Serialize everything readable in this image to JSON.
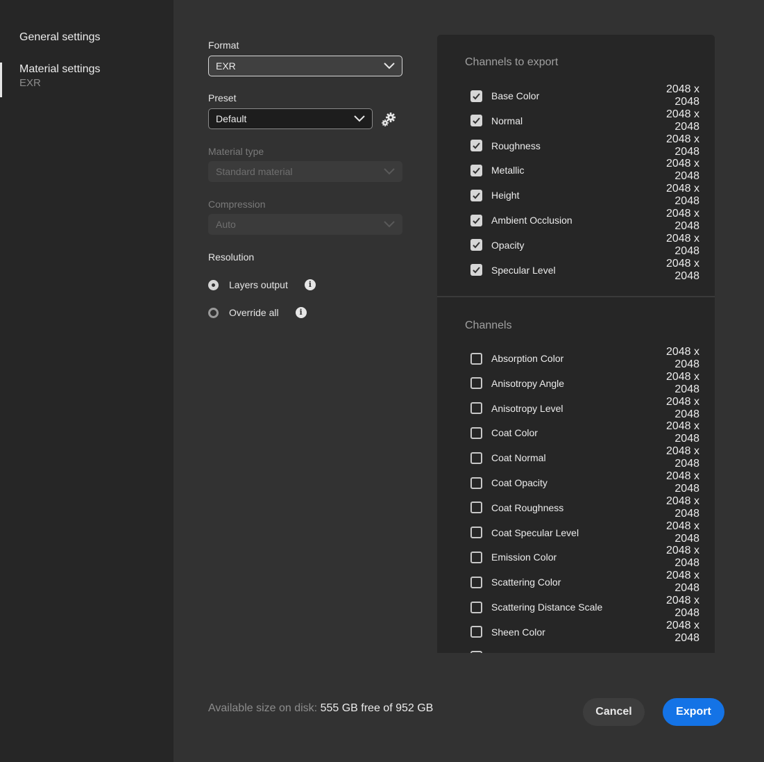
{
  "sidebar": {
    "items": [
      {
        "label": "General settings",
        "sublabel": null,
        "active": false
      },
      {
        "label": "Material settings",
        "sublabel": "EXR",
        "active": true
      }
    ]
  },
  "form": {
    "format": {
      "label": "Format",
      "value": "EXR"
    },
    "preset": {
      "label": "Preset",
      "value": "Default",
      "settings_icon": "gears-icon"
    },
    "material_type": {
      "label": "Material type",
      "value": "Standard material",
      "disabled": true
    },
    "compression": {
      "label": "Compression",
      "value": "Auto",
      "disabled": true
    },
    "resolution": {
      "label": "Resolution",
      "options": [
        {
          "label": "Layers output",
          "selected": true,
          "info_icon": "info-icon"
        },
        {
          "label": "Override all",
          "selected": false,
          "info_icon": "info-icon"
        }
      ]
    }
  },
  "channels_to_export": {
    "title": "Channels to export",
    "items": [
      {
        "name": "Base Color",
        "resolution": "2048 x 2048",
        "checked": true
      },
      {
        "name": "Normal",
        "resolution": "2048 x 2048",
        "checked": true
      },
      {
        "name": "Roughness",
        "resolution": "2048 x 2048",
        "checked": true
      },
      {
        "name": "Metallic",
        "resolution": "2048 x 2048",
        "checked": true
      },
      {
        "name": "Height",
        "resolution": "2048 x 2048",
        "checked": true
      },
      {
        "name": "Ambient Occlusion",
        "resolution": "2048 x 2048",
        "checked": true
      },
      {
        "name": "Opacity",
        "resolution": "2048 x 2048",
        "checked": true
      },
      {
        "name": "Specular Level",
        "resolution": "2048 x 2048",
        "checked": true
      }
    ]
  },
  "channels": {
    "title": "Channels",
    "items": [
      {
        "name": "Absorption Color",
        "resolution": "2048 x 2048",
        "checked": false
      },
      {
        "name": "Anisotropy Angle",
        "resolution": "2048 x 2048",
        "checked": false
      },
      {
        "name": "Anisotropy Level",
        "resolution": "2048 x 2048",
        "checked": false
      },
      {
        "name": "Coat Color",
        "resolution": "2048 x 2048",
        "checked": false
      },
      {
        "name": "Coat Normal",
        "resolution": "2048 x 2048",
        "checked": false
      },
      {
        "name": "Coat Opacity",
        "resolution": "2048 x 2048",
        "checked": false
      },
      {
        "name": "Coat Roughness",
        "resolution": "2048 x 2048",
        "checked": false
      },
      {
        "name": "Coat Specular Level",
        "resolution": "2048 x 2048",
        "checked": false
      },
      {
        "name": "Emission Color",
        "resolution": "2048 x 2048",
        "checked": false
      },
      {
        "name": "Scattering Color",
        "resolution": "2048 x 2048",
        "checked": false
      },
      {
        "name": "Scattering Distance Scale",
        "resolution": "2048 x 2048",
        "checked": false
      },
      {
        "name": "Sheen Color",
        "resolution": "2048 x 2048",
        "checked": false
      },
      {
        "name": "",
        "resolution": "",
        "checked": false
      }
    ]
  },
  "footer": {
    "disk_label": "Available size on disk:",
    "disk_value": "555 GB free of 952 GB",
    "cancel_label": "Cancel",
    "export_label": "Export"
  },
  "colors": {
    "accent": "#1473e6",
    "sidebar_bg": "#262626",
    "main_bg": "#323232",
    "panel_bg": "#262626"
  }
}
